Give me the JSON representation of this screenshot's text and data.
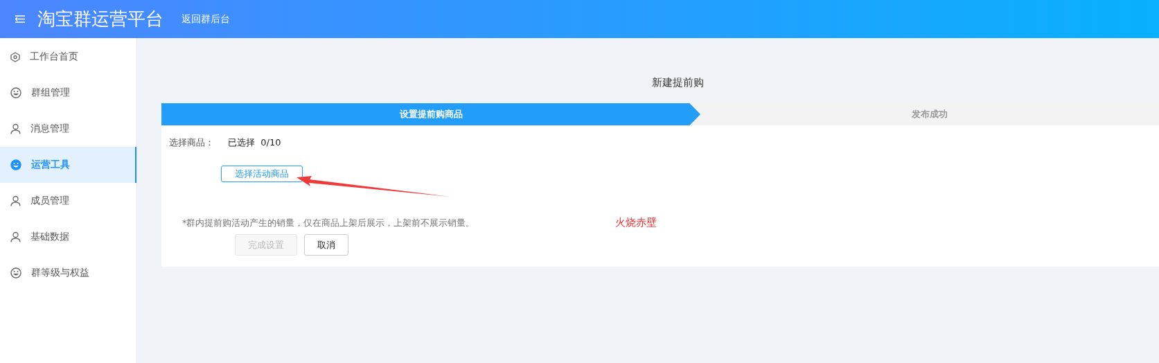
{
  "header": {
    "title": "淘宝群运营平台",
    "back_link": "返回群后台"
  },
  "sidebar": {
    "items": [
      {
        "label": "工作台首页",
        "kind": "hexagon",
        "selected": false
      },
      {
        "label": "群组管理",
        "kind": "smiley",
        "selected": false
      },
      {
        "label": "消息管理",
        "kind": "person",
        "selected": false
      },
      {
        "label": "运营工具",
        "kind": "smiley",
        "selected": true
      },
      {
        "label": "成员管理",
        "kind": "person",
        "selected": false
      },
      {
        "label": "基础数据",
        "kind": "person",
        "selected": false
      },
      {
        "label": "群等级与权益",
        "kind": "smiley",
        "selected": false
      }
    ]
  },
  "page_title": "新建提前购",
  "steps": [
    {
      "label": "设置提前购商品",
      "selected": true
    },
    {
      "label": "发布成功",
      "selected": false
    }
  ],
  "form": {
    "label": "选择商品：",
    "value": "已选择  0/10",
    "select_button": "选择活动商品",
    "note": "*群内提前购活动产生的销量，仅在商品上架后展示，上架前不展示销量。",
    "buttons": [
      {
        "label": "完成设置",
        "disabled": true
      },
      {
        "label": "取消",
        "disabled": false
      }
    ]
  },
  "annotation": {
    "text": "火烧赤壁"
  }
}
